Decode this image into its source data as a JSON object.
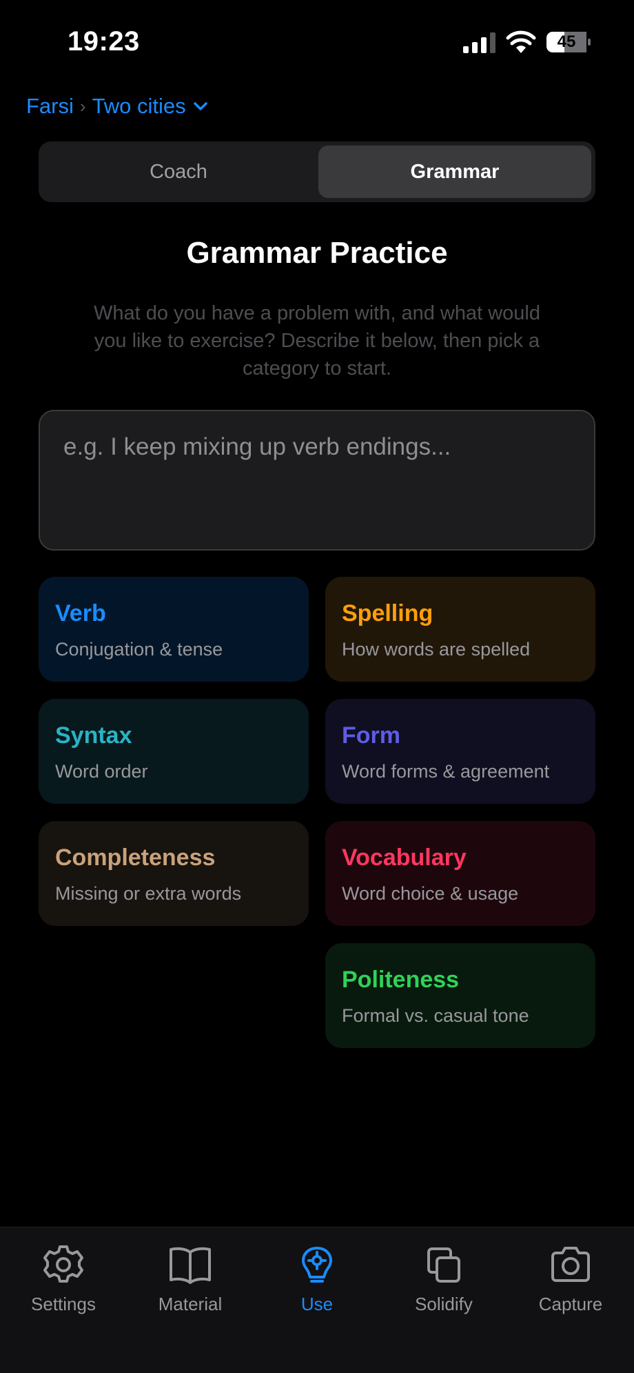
{
  "status_bar": {
    "time": "19:23",
    "battery_level": "45"
  },
  "breadcrumb": {
    "language": "Farsi",
    "separator": "›",
    "material": "Two cities"
  },
  "segmented_control": {
    "options": [
      "Coach",
      "Grammar"
    ],
    "selected": "Grammar"
  },
  "page": {
    "title": "Grammar Practice",
    "description": "What do you have a problem with, and what would you like to exercise? Describe it below, then pick a category to start.",
    "input_placeholder": "e.g. I keep mixing up verb endings...",
    "input_value": ""
  },
  "categories": [
    {
      "title": "Verb",
      "subtitle": "Conjugation & tense",
      "accent": "#1a8cff",
      "background": "#031629"
    },
    {
      "title": "Spelling",
      "subtitle": "How words are spelled",
      "accent": "#ff9f0a",
      "background": "#211709"
    },
    {
      "title": "Syntax",
      "subtitle": "Word order",
      "accent": "#2ab3c6",
      "background": "#07191c"
    },
    {
      "title": "Form",
      "subtitle": "Word forms & agreement",
      "accent": "#5e5ce6",
      "background": "#0f0f21"
    },
    {
      "title": "Completeness",
      "subtitle": "Missing or extra words",
      "accent": "#c9a27b",
      "background": "#17130f"
    },
    {
      "title": "Vocabulary",
      "subtitle": "Word choice & usage",
      "accent": "#ff375f",
      "background": "#1d070d"
    },
    {
      "title": "Politeness",
      "subtitle": "Formal vs. casual tone",
      "accent": "#30d158",
      "background": "#081a0e"
    }
  ],
  "tab_bar": {
    "items": [
      {
        "label": "Settings",
        "icon": "gear-icon"
      },
      {
        "label": "Material",
        "icon": "book-icon"
      },
      {
        "label": "Use",
        "icon": "brain-icon"
      },
      {
        "label": "Solidify",
        "icon": "copy-icon"
      },
      {
        "label": "Capture",
        "icon": "camera-icon"
      }
    ],
    "active": "Use",
    "active_color": "#1a8cff",
    "inactive_color": "#98989d"
  }
}
